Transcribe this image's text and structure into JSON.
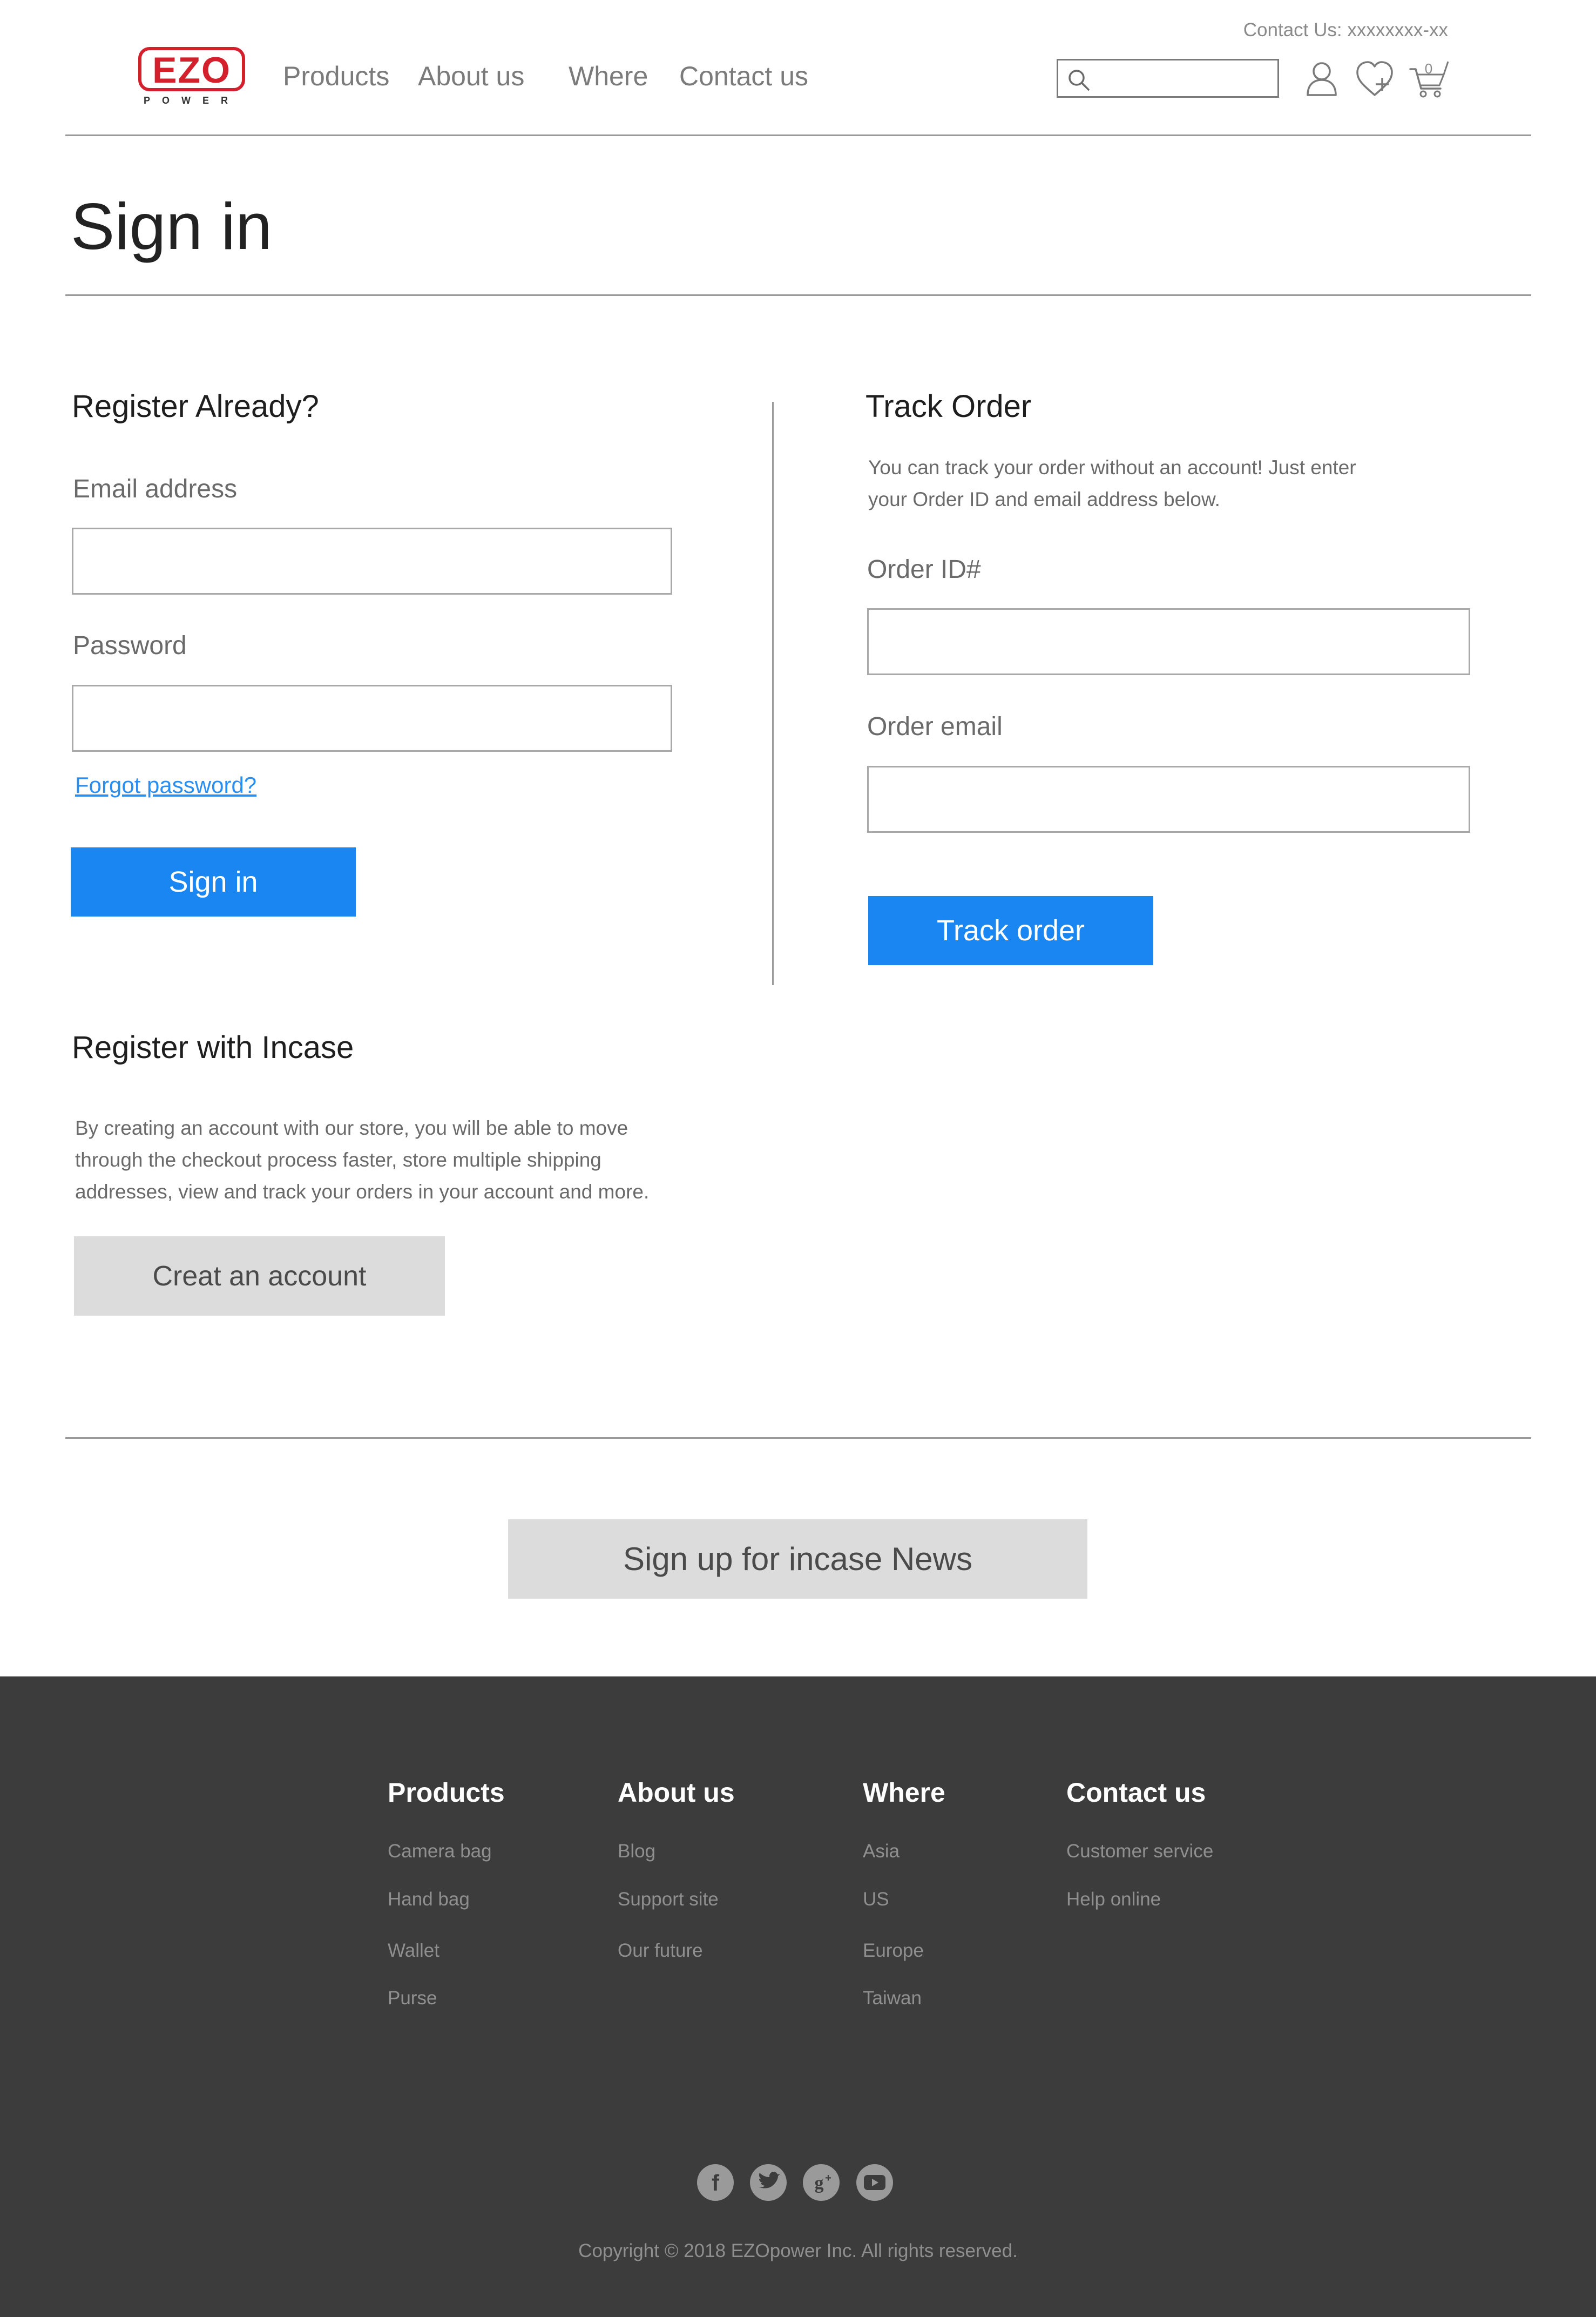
{
  "header": {
    "contact": "Contact Us: xxxxxxxx-xx",
    "logo_text": "EZO",
    "logo_subtext": "POWER",
    "nav": [
      "Products",
      "About us",
      "Where",
      "Contact us"
    ],
    "search_placeholder": "",
    "cart_count": "0",
    "icons": [
      "search-icon",
      "user-icon",
      "wishlist-icon",
      "cart-icon"
    ]
  },
  "page": {
    "title": "Sign in"
  },
  "signin": {
    "heading": "Register Already?",
    "email_label": "Email address",
    "email_value": "",
    "password_label": "Password",
    "password_value": "",
    "forgot": "Forgot password?",
    "button": "Sign in"
  },
  "track": {
    "heading": "Track Order",
    "desc_line1": "You can track your order without an account! Just enter",
    "desc_line2": "your Order ID and email address below.",
    "order_id_label": "Order ID#",
    "order_id_value": "",
    "order_email_label": "Order email",
    "order_email_value": "",
    "button": "Track order"
  },
  "register": {
    "heading": "Register with Incase",
    "desc_line1": "By creating an account with our store, you will be able to move",
    "desc_line2": "through the checkout process faster, store multiple shipping",
    "desc_line3": "addresses, view and track your orders in your account and more.",
    "button": "Creat an account"
  },
  "newsletter": {
    "button": "Sign up for incase News"
  },
  "footer": {
    "columns": [
      {
        "title": "Products",
        "links": [
          "Camera bag",
          "Hand bag",
          "Wallet",
          "Purse"
        ]
      },
      {
        "title": "About us",
        "links": [
          "Blog",
          "Support site",
          "Our future"
        ]
      },
      {
        "title": "Where",
        "links": [
          "Asia",
          "US",
          "Europe",
          "Taiwan"
        ]
      },
      {
        "title": "Contact us",
        "links": [
          "Customer service",
          "Help online"
        ]
      }
    ],
    "social": [
      "facebook-icon",
      "twitter-icon",
      "google-plus-icon",
      "youtube-icon"
    ],
    "copyright": "Copyright © 2018 EZOpower Inc. All rights reserved."
  },
  "colors": {
    "accent": "#1a86f1",
    "logo_red": "#d4202c",
    "footer_bg": "#3c3c3c",
    "button_gray": "#dcdcdc"
  }
}
